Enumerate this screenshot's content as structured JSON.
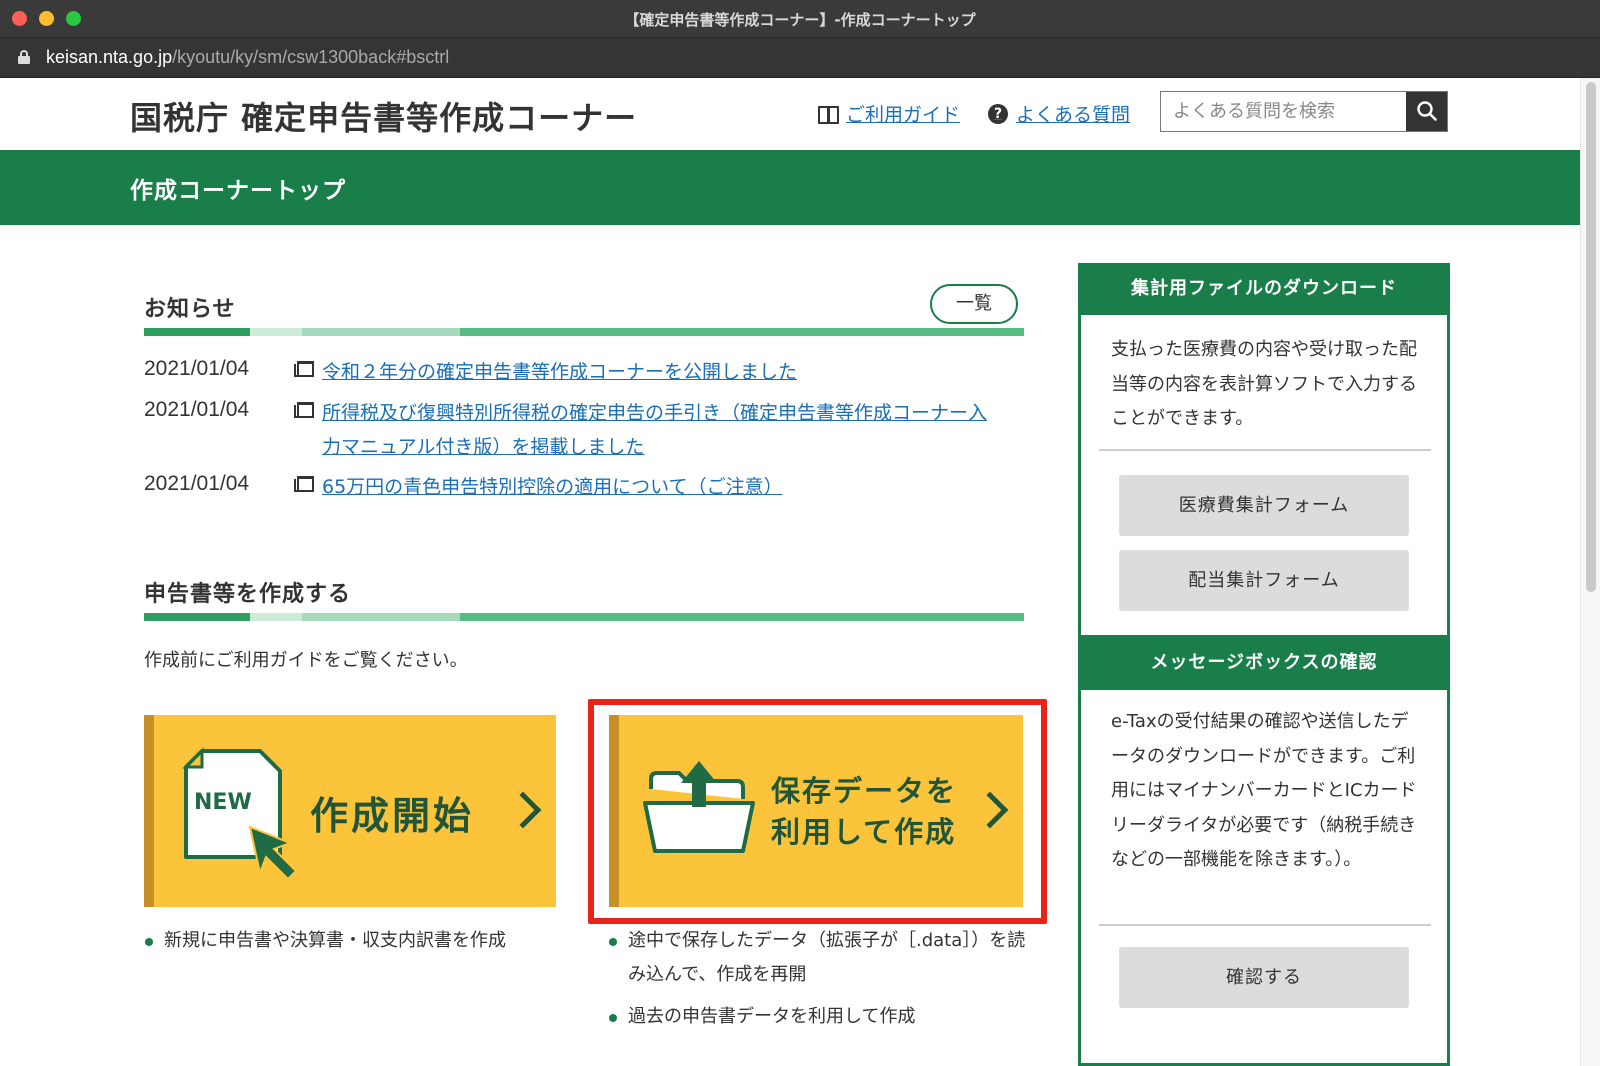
{
  "window": {
    "title": "【確定申告書等作成コーナー】-作成コーナートップ",
    "url_host": "keisan.nta.go.jp",
    "url_path": "/kyoutu/ky/sm/csw1300back#bsctrl"
  },
  "header": {
    "site_title": "国税庁 確定申告書等作成コーナー",
    "guide_link": "ご利用ガイド",
    "faq_link": "よくある質問",
    "search_placeholder": "よくある質問を検索",
    "search_value": ""
  },
  "banner": {
    "title": "作成コーナートップ"
  },
  "notices": {
    "title": "お知らせ",
    "list_button": "一覧",
    "items": [
      {
        "date": "2021/01/04",
        "text": "令和２年分の確定申告書等作成コーナーを公開しました"
      },
      {
        "date": "2021/01/04",
        "text": "所得税及び復興特別所得税の確定申告の手引き（確定申告書等作成コーナー入力マニュアル付き版）を掲載しました"
      },
      {
        "date": "2021/01/04",
        "text": "65万円の青色申告特別控除の適用について（ご注意）"
      }
    ]
  },
  "create": {
    "title": "申告書等を作成する",
    "description": "作成前にご利用ガイドをご覧ください。",
    "start_button": {
      "label": "作成開始",
      "icon_text": "NEW"
    },
    "saved_button": {
      "label_line1": "保存データを",
      "label_line2": "利用して作成"
    },
    "start_bullets": [
      "新規に申告書や決算書・収支内訳書を作成"
    ],
    "saved_bullets": [
      "途中で保存したデータ（拡張子が［.data］）を読み込んで、作成を再開",
      "過去の申告書データを利用して作成"
    ]
  },
  "sidebar": {
    "download": {
      "title": "集計用ファイルのダウンロード",
      "text": "支払った医療費の内容や受け取った配当等の内容を表計算ソフトで入力することができます。",
      "buttons": [
        "医療費集計フォーム",
        "配当集計フォーム"
      ]
    },
    "messagebox": {
      "title": "メッセージボックスの確認",
      "text": "e-Taxの受付結果の確認や送信したデータのダウンロードができます。ご利用にはマイナンバーカードとICカードリーダライタが必要です（納税手続きなどの一部機能を除きます。）。",
      "button": "確認する"
    }
  },
  "colors": {
    "brand_green": "#1a7e4a",
    "button_yellow": "#fbc43a",
    "link_blue": "#1a6fb7",
    "highlight_red": "#e8231a"
  }
}
